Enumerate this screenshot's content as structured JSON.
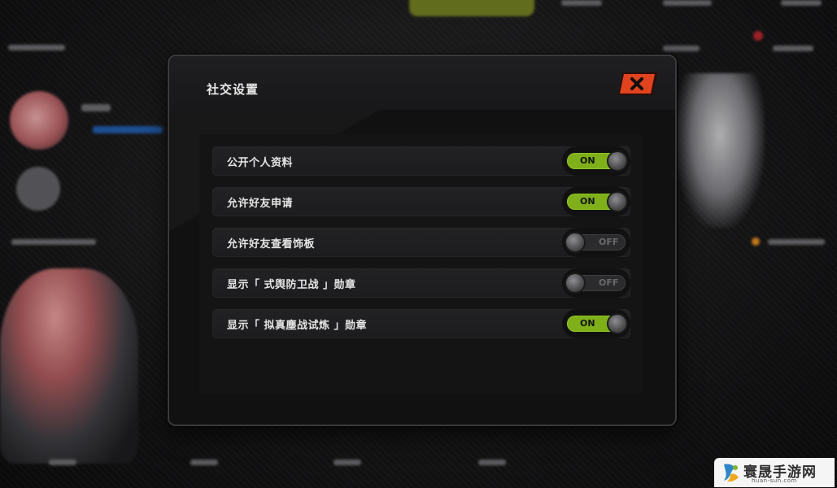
{
  "dialog": {
    "title": "社交设置",
    "close_icon": "close-x-icon",
    "settings": [
      {
        "label": "公开个人资料",
        "state": "ON",
        "enabled": true
      },
      {
        "label": "允许好友申请",
        "state": "ON",
        "enabled": true
      },
      {
        "label": "允许好友查看饰板",
        "state": "OFF",
        "enabled": false
      },
      {
        "label": "显示「 式舆防卫战 」勋章",
        "state": "OFF",
        "enabled": false
      },
      {
        "label": "显示「 拟真塵战试炼 」勋章",
        "state": "ON",
        "enabled": true
      }
    ]
  },
  "colors": {
    "toggle_on": "#7fb01a",
    "close_button": "#e2431f",
    "dialog_bg": "#0f0f10"
  },
  "watermark": {
    "title": "寰晟手游网",
    "url": "huan-sun.com"
  }
}
